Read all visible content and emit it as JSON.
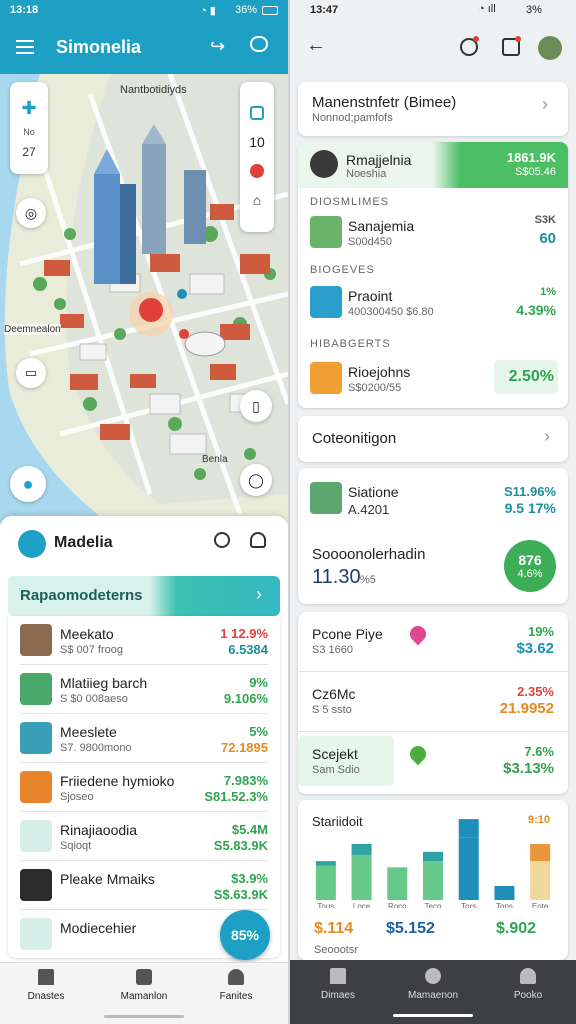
{
  "left": {
    "status": {
      "time": "13:18",
      "battery": "36%"
    },
    "appbar": {
      "title": "Simonelia"
    },
    "map": {
      "label_top": "Nantbotidiyds",
      "label_left": "Deemnealon",
      "label_bottom": "Benla",
      "control_a": "10",
      "side_a": "No",
      "side_b": "27"
    },
    "header": {
      "title": "Madelia"
    },
    "banner": {
      "title": "Rapaomodeterns"
    },
    "list": [
      {
        "name": "Meekato",
        "sub": "S$ 007 froog",
        "top": "1 12.9%",
        "bottom": "6.5384",
        "top_color": "#e0403a",
        "bottom_color": "#1a8fa0",
        "thumb": "#8b6a4e"
      },
      {
        "name": "Mlatiieg barch",
        "sub": "S $0 008aeso",
        "top": "9%",
        "bottom": "9.106%",
        "top_color": "#2ea44f",
        "bottom_color": "#2ea44f",
        "thumb": "#4aa86a"
      },
      {
        "name": "Meeslete",
        "sub": "S7. 9800mono",
        "top": "5%",
        "bottom": "72.1895",
        "top_color": "#2ea44f",
        "bottom_color": "#e48a1f",
        "thumb": "#3aa0b8"
      },
      {
        "name": "Friiedene hymioko",
        "sub": "Sjoseo",
        "top": "7.983%",
        "bottom": "S81.52.3%",
        "top_color": "#2ea44f",
        "bottom_color": "#2ea44f",
        "thumb": "#e8842a"
      },
      {
        "name": "Rinajiaoodia",
        "sub": "Sqioqt",
        "top": "$5.4M",
        "bottom": "S5.83.9K",
        "top_color": "#2ea44f",
        "bottom_color": "#2ea44f",
        "thumb": "#d6efe8"
      },
      {
        "name": "Pleake Mmaiks",
        "sub": "",
        "top": "$3.9%",
        "bottom": "S$.63.9K",
        "top_color": "#2ea44f",
        "bottom_color": "#2ea44f",
        "thumb": "#2b2b2b"
      },
      {
        "name": "Modiecehier",
        "sub": "",
        "top": "",
        "bottom": "",
        "top_color": "#2ea44f",
        "bottom_color": "#2ea44f",
        "thumb": "#d6efe8"
      }
    ],
    "fab": "85%",
    "nav": [
      "Dnastes",
      "Mamanlon",
      "Fanites"
    ]
  },
  "right": {
    "status": {
      "time": "13:47",
      "battery": "3%"
    },
    "section_card": {
      "title": "Manenstnfetr (Bimee)",
      "subtitle": "Nonnod;pamfofs"
    },
    "highlight": {
      "name": "Rmajjelnia",
      "sub": "Noeshia",
      "top": "1861.9K",
      "bottom": "S$05.46"
    },
    "group1": {
      "label": "DIOSMLIMES",
      "name": "Sanajemia",
      "sub": "S00d450",
      "top": "S3K",
      "bottom": "60"
    },
    "group2": {
      "label": "BIOGEVES",
      "name": "Praoint",
      "sub": "400300450 $6.80",
      "top": "1%",
      "bottom": "4.39%"
    },
    "group3": {
      "label": "HIBABGERTS",
      "name": "Rioejohns",
      "sub": "S$0200/55",
      "value": "2.50%"
    },
    "collection": {
      "title": "Coteonitigon"
    },
    "stats": {
      "name": "Siatione",
      "sub": "A.4201",
      "top": "S11.96%",
      "bottom": "9.5 17%",
      "big_label": "Soooonolerhadin",
      "big_value": "11.30",
      "big_unit": "%5",
      "badge_top": "876",
      "badge_bottom": "4.6%"
    },
    "places": [
      {
        "name": "Pcone Piye",
        "sub": "S3 1660",
        "top": "19%",
        "bottom": "$3.62",
        "top_color": "#2ea44f",
        "bottom_color": "#1d8fb8"
      },
      {
        "name": "Cz6Mc",
        "sub": "S 5 ssto",
        "top": "2.35%",
        "bottom": "21.9952",
        "top_color": "#e0403a",
        "bottom_color": "#e48a1f"
      },
      {
        "name": "Scejekt",
        "sub": "Sam Sdio",
        "top": "7.6%",
        "bottom": "$3.13%",
        "top_color": "#2ea44f",
        "bottom_color": "#2ea44f"
      }
    ],
    "chart_card": {
      "title": "Stariidoit",
      "corner": "9:10",
      "footer_left": "$.114",
      "footer_mid": "$5.152",
      "footer_right": "$.902",
      "footer_bottom": "Seoootsr"
    },
    "nav": [
      "Dimaes",
      "Mamaenon",
      "Pooko"
    ]
  },
  "chart_data": {
    "type": "bar",
    "title": "Stariidoit",
    "categories": [
      "Tous",
      "Loce",
      "Roco",
      "Teco",
      "Tors",
      "Tops",
      "Eote"
    ],
    "series": [
      {
        "values": [
          2.2,
          2.9,
          2.1,
          2.5,
          4.0,
          0.9,
          2.5
        ]
      },
      {
        "values": [
          0.3,
          0.7,
          0.0,
          0.6,
          1.2,
          0.0,
          1.1
        ]
      }
    ],
    "ylim": [
      0,
      4.5
    ],
    "colors": [
      "#66c98a",
      "#1d8fb8",
      "#e8963a"
    ]
  }
}
